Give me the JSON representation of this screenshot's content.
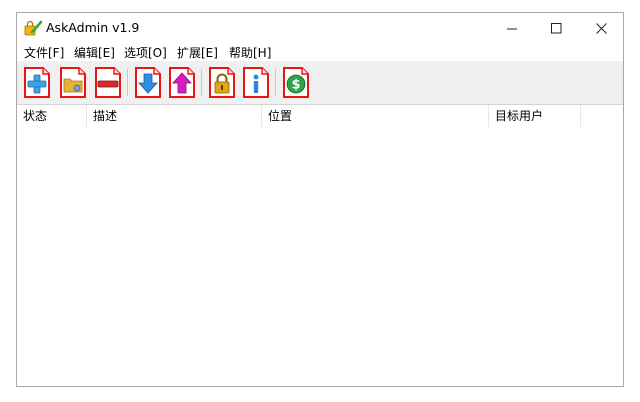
{
  "window": {
    "title": "AskAdmin v1.9",
    "controls": {
      "minimize_icon": "minimize-icon",
      "maximize_icon": "maximize-icon",
      "close_icon": "close-icon"
    }
  },
  "menu": [
    "文件[F]",
    "编辑[E]",
    "选项[O]",
    "扩展[E]",
    "帮助[H]"
  ],
  "toolbar": {
    "buttons": [
      {
        "icon": "add-file-icon",
        "color": "#3aa3e6"
      },
      {
        "icon": "folder-file-icon",
        "color": "#e8b13a"
      },
      {
        "icon": "remove-file-icon",
        "color": "#d92b2b"
      },
      {
        "icon": "arrow-down-icon",
        "color": "#2f8fe0"
      },
      {
        "icon": "arrow-up-icon",
        "color": "#d61ebb"
      },
      {
        "icon": "lock-icon",
        "color": "#e4a416"
      },
      {
        "icon": "info-icon",
        "color": "#2a86d6"
      },
      {
        "icon": "dollar-icon",
        "color": "#2ea24a"
      }
    ]
  },
  "table": {
    "columns": [
      "状态",
      "描述",
      "位置",
      "目标用户"
    ],
    "rows": []
  },
  "colors": {
    "toolbar_bg": "#f0f0f0",
    "page_red": "#e81515"
  }
}
